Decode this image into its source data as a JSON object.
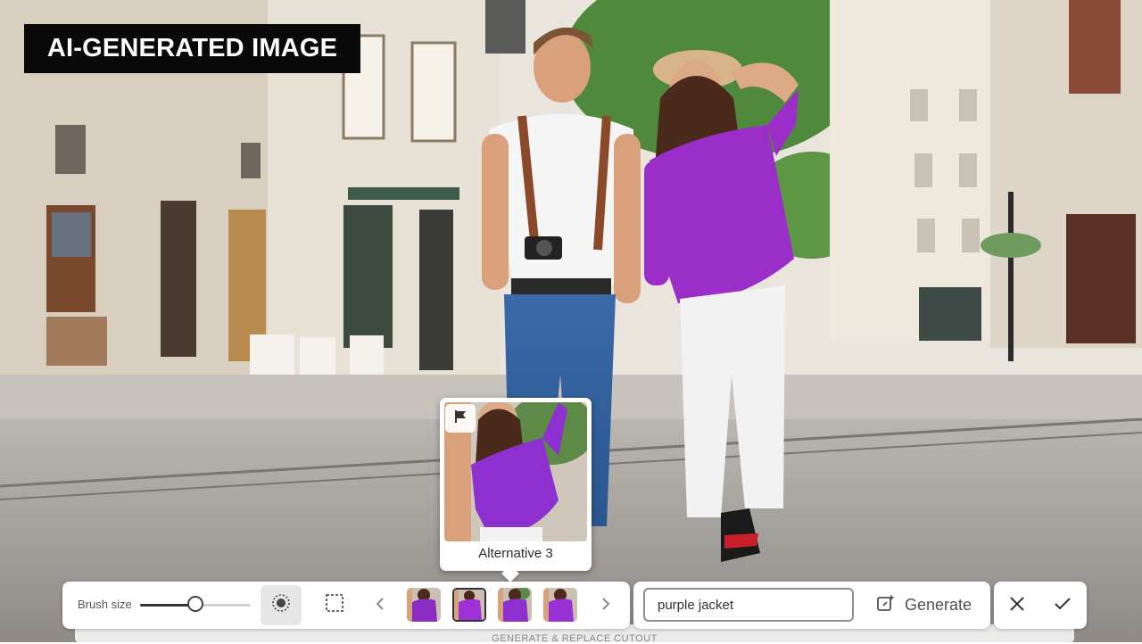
{
  "overlay": {
    "ai_label": "AI-GENERATED IMAGE"
  },
  "preview": {
    "caption": "Alternative 3",
    "flag_icon": "flag-icon"
  },
  "toolbar": {
    "brush_size_label": "Brush size",
    "brush_size_fraction": 0.5,
    "variants": [
      {
        "id": "alt-1",
        "selected": false
      },
      {
        "id": "alt-2",
        "selected": true
      },
      {
        "id": "alt-3",
        "selected": false
      },
      {
        "id": "alt-4",
        "selected": false
      }
    ],
    "prompt_value": "purple jacket",
    "generate_label": "Generate",
    "subtitle": "GENERATE & REPLACE CUTOUT",
    "icons": {
      "brush": "brush-tool-icon",
      "selection": "rect-selection-icon",
      "prev": "chevron-left-icon",
      "next": "chevron-right-icon",
      "generate": "generate-sparkle-icon",
      "cancel": "close-icon",
      "confirm": "check-icon"
    }
  },
  "colors": {
    "jacket": "#9b2ec9",
    "overlay_bg": "#0a0a0a"
  }
}
